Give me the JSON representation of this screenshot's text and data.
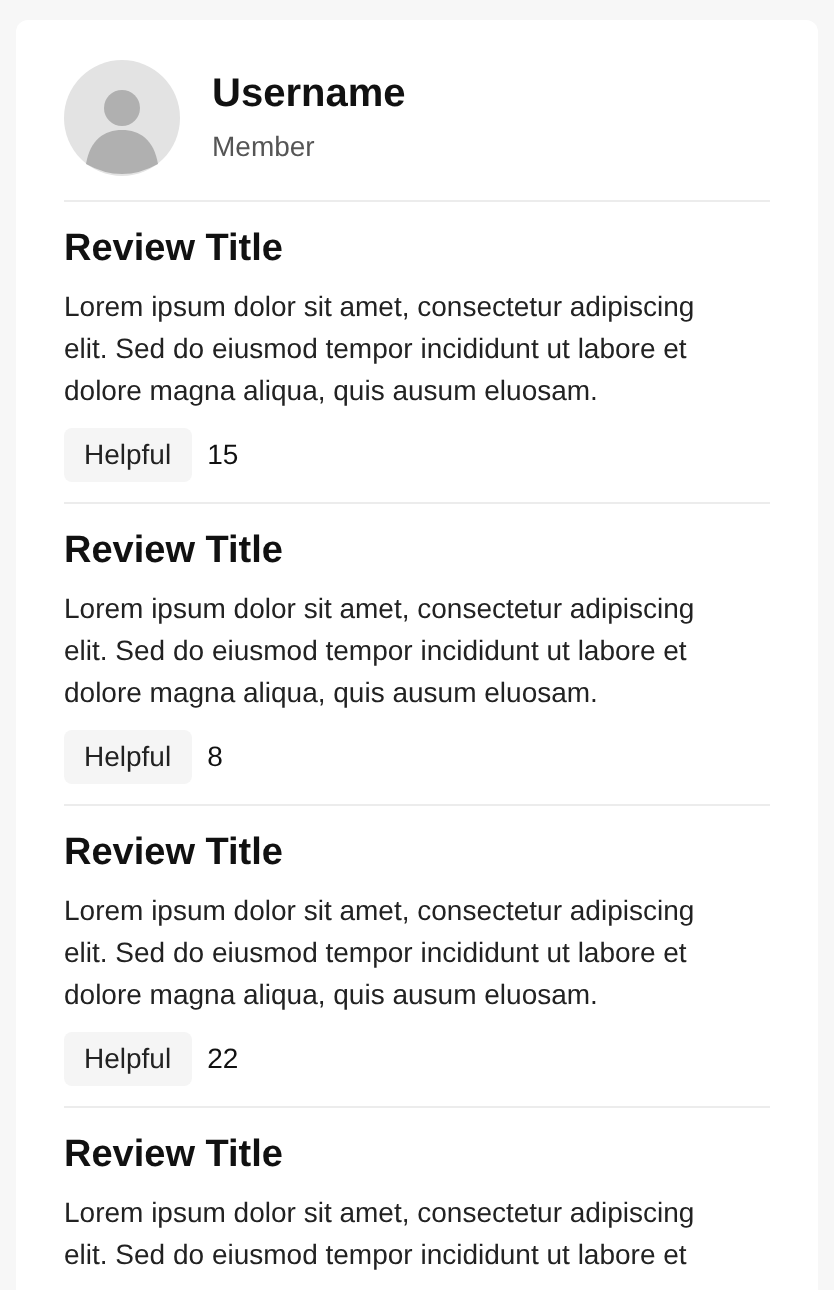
{
  "profile": {
    "username": "Username",
    "role": "Member"
  },
  "reviews": [
    {
      "title": "Review Title",
      "body": "Lorem ipsum dolor sit amet, consectetur adipiscing elit. Sed do eiusmod tempor incididunt ut labore et dolore magna aliqua, quis ausum eluosam.",
      "helpful_label": "Helpful",
      "helpful_count": "15"
    },
    {
      "title": "Review Title",
      "body": "Lorem ipsum dolor sit amet, consectetur adipiscing elit. Sed do eiusmod tempor incididunt ut labore et dolore magna aliqua, quis ausum eluosam.",
      "helpful_label": "Helpful",
      "helpful_count": "8"
    },
    {
      "title": "Review Title",
      "body": "Lorem ipsum dolor sit amet, consectetur adipiscing elit. Sed do eiusmod tempor incididunt ut labore et dolore magna aliqua, quis ausum eluosam.",
      "helpful_label": "Helpful",
      "helpful_count": "22"
    },
    {
      "title": "Review Title",
      "body": "Lorem ipsum dolor sit amet, consectetur adipiscing elit. Sed do eiusmod tempor incididunt ut labore et"
    }
  ]
}
